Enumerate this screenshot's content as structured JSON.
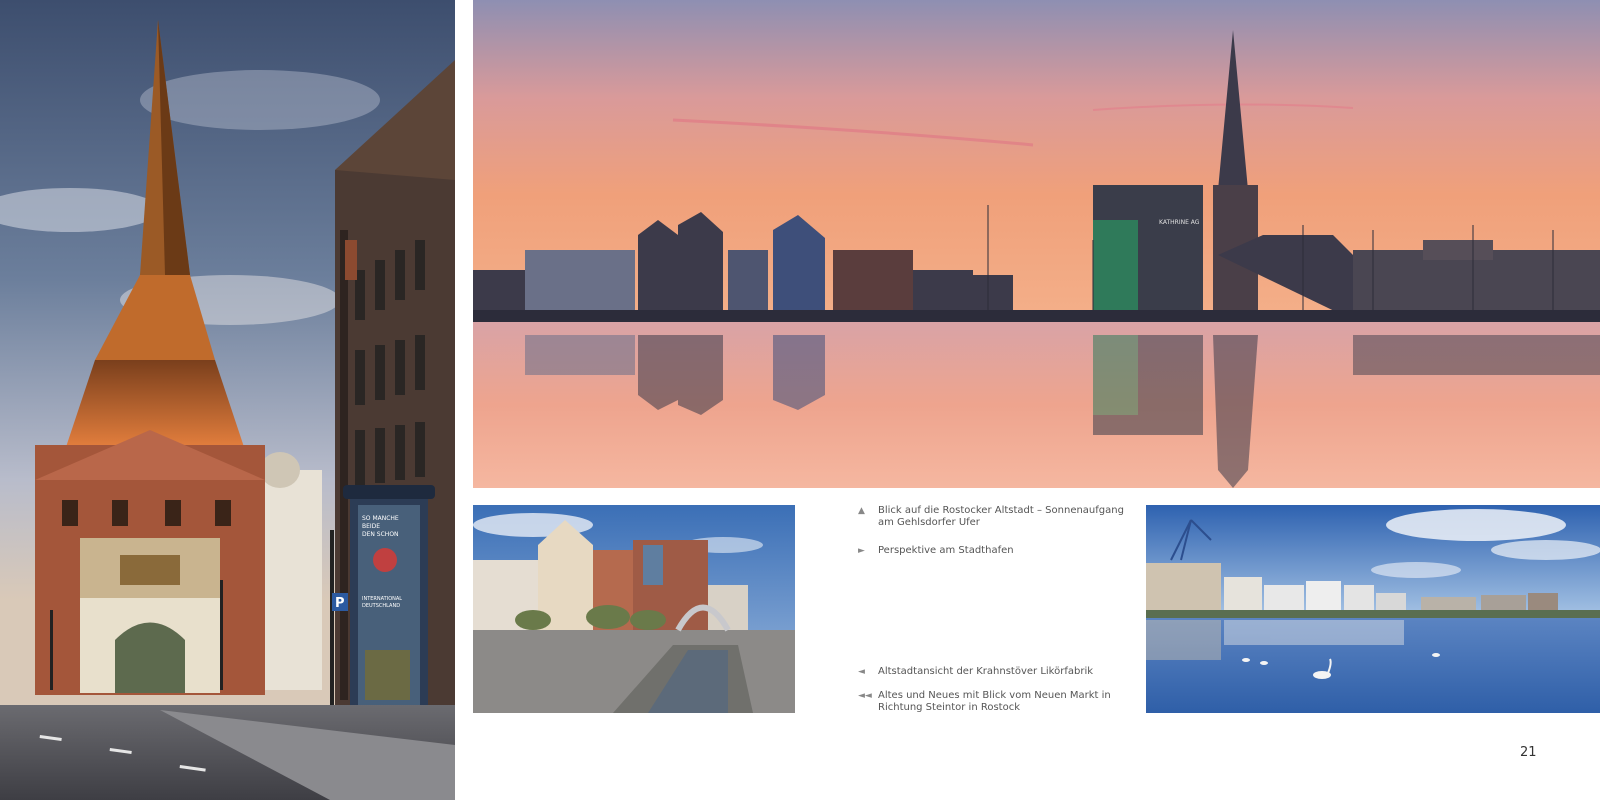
{
  "page": {
    "number": "21"
  },
  "photos": {
    "left": {
      "poster": {
        "line1": "SO MANCHE",
        "line2": "BEIDE",
        "line3": "DEN SCHON",
        "line4": "INTERNATIONAL",
        "line5": "DEUTSCHLAND"
      },
      "parking_sign": "P"
    },
    "top": {
      "building_sign": "KATHRINE AG"
    }
  },
  "captions": [
    {
      "arrow": "▲",
      "text": "Blick auf die Rostocker Altstadt – Sonnenaufgang am Gehlsdorfer Ufer"
    },
    {
      "arrow": "►",
      "text": "Perspektive am Stadthafen"
    },
    {
      "arrow": "◄",
      "text": "Altstadtansicht der Krahnstöver Likörfabrik"
    },
    {
      "arrow": "◄◄",
      "text": "Altes und Neues mit Blick vom Neuen Markt in Richtung Steintor in Rostock"
    }
  ],
  "colors": {
    "sunrise_top": "#8e8fb2",
    "sunrise_mid": "#f0a07a",
    "water_blue": "#2f5fa8",
    "brick": "#a4563a"
  }
}
